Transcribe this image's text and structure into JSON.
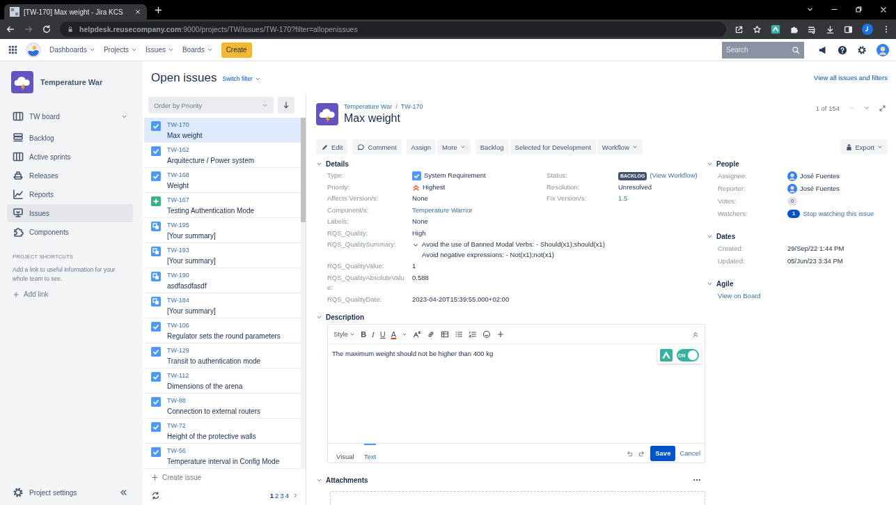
{
  "browser": {
    "tab_title": "[TW-170] Max weight - Jira KCS",
    "url": "**helpdesk.reusecompany.com**:9000/projects/TW/issues/TW-170?filter=allopenissues"
  },
  "topnav": {
    "menus": [
      "Dashboards",
      "Projects",
      "Issues",
      "Boards"
    ],
    "create": "Create",
    "search_placeholder": "Search"
  },
  "sidebar": {
    "project": "Temperature War",
    "items": [
      {
        "label": "TW board",
        "selected": false,
        "kind": "dropdown"
      },
      {
        "label": "Backlog",
        "selected": false,
        "kind": "link"
      },
      {
        "label": "Active sprints",
        "selected": false,
        "kind": "link"
      },
      {
        "label": "Releases",
        "selected": false,
        "kind": "link"
      },
      {
        "label": "Reports",
        "selected": false,
        "kind": "link"
      },
      {
        "label": "Issues",
        "selected": true,
        "kind": "link"
      },
      {
        "label": "Components",
        "selected": false,
        "kind": "link"
      }
    ],
    "shortcuts_heading": "PROJECT SHORTCUTS",
    "shortcuts_text": "Add a link to useful information for your whole team to see.",
    "add_link": "Add link",
    "settings": "Project settings"
  },
  "header": {
    "title": "Open issues",
    "switch_filter": "Switch filter",
    "view_all": "View all issues and filters"
  },
  "issue_list": {
    "order": "Order by Priority",
    "items": [
      {
        "key": "TW-170",
        "summary": "Max weight",
        "kind": "requirement",
        "selected": true
      },
      {
        "key": "TW-162",
        "summary": "Arquitecture / Power system",
        "kind": "requirement",
        "selected": false
      },
      {
        "key": "TW-168",
        "summary": "Weight",
        "kind": "requirement",
        "selected": false
      },
      {
        "key": "TW-167",
        "summary": "Testing Authentication Mode",
        "kind": "new-feature",
        "selected": false
      },
      {
        "key": "TW-195",
        "summary": "[Your summary]",
        "kind": "sub-task",
        "selected": false
      },
      {
        "key": "TW-193",
        "summary": "[Your summary]",
        "kind": "sub-task",
        "selected": false
      },
      {
        "key": "TW-190",
        "summary": "asdfasdfasdf",
        "kind": "sub-task",
        "selected": false
      },
      {
        "key": "TW-184",
        "summary": "[Your summary]",
        "kind": "sub-task",
        "selected": false
      },
      {
        "key": "TW-106",
        "summary": "Regulator sets the round parameters",
        "kind": "requirement",
        "selected": false
      },
      {
        "key": "TW-129",
        "summary": "Transit to authentication mode",
        "kind": "requirement",
        "selected": false
      },
      {
        "key": "TW-112",
        "summary": "Dimensions of the arena",
        "kind": "requirement",
        "selected": false
      },
      {
        "key": "TW-88",
        "summary": "Connection to external routers",
        "kind": "requirement",
        "selected": false
      },
      {
        "key": "TW-72",
        "summary": "Height of the protective walls",
        "kind": "requirement",
        "selected": false
      },
      {
        "key": "TW-56",
        "summary": "Temperature interval in Config Mode",
        "kind": "requirement",
        "selected": false
      }
    ],
    "create": "Create issue",
    "pages": [
      {
        "label": "1",
        "selected": true
      },
      {
        "label": "2",
        "selected": false
      },
      {
        "label": "3",
        "selected": false
      },
      {
        "label": "4",
        "selected": false
      }
    ]
  },
  "issue": {
    "breadcrumb": [
      "Temperature War",
      "TW-170"
    ],
    "separator": "/",
    "title": "Max weight",
    "toolbar": [
      [
        {
          "label": "Edit",
          "kind": "edit"
        }
      ],
      [
        {
          "label": "Comment",
          "kind": "comment"
        }
      ],
      [
        {
          "label": "Assign",
          "kind": "action"
        },
        {
          "label": "More",
          "kind": "menu"
        }
      ],
      [
        {
          "label": "Backlog",
          "kind": "action"
        },
        {
          "label": "Selected for Development",
          "kind": "action"
        },
        {
          "label": "Workflow",
          "kind": "menu"
        }
      ]
    ],
    "details_heading": "Details",
    "fields": [
      {
        "label": "Type:",
        "value": "System Requirement",
        "kind": "type"
      },
      {
        "label": "Priority:",
        "value": "Highest",
        "kind": "priority"
      },
      {
        "label": "Affects Version/s:",
        "value": "None",
        "kind": "text"
      },
      {
        "label": "Component/s:",
        "value": "Temperature Warrior",
        "kind": "link"
      },
      {
        "label": "Labels:",
        "value": "None",
        "kind": "text"
      },
      {
        "label": "RQS_Quality:",
        "value": "High",
        "kind": "text"
      },
      {
        "label": "RQS_QualitySummary:",
        "kind": "list",
        "expanded": true,
        "lines": [
          "Avoid the use of Banned Modal Verbs: - Should(x1);should(x1)",
          "Avoid negative expressions: - Not(x1);not(x1)"
        ]
      },
      {
        "label": "RQS_QualityValue:",
        "value": "1",
        "kind": "text"
      },
      {
        "label": "RQS_QualityAbsoluteValue:",
        "value": "0.588",
        "kind": "text"
      },
      {
        "label": "RQS_QualityDate:",
        "value": "2023-04-20T15:39:55.000+02:00",
        "kind": "text"
      }
    ],
    "side_fields": [
      {
        "label": "Status:",
        "kind": "status",
        "value": "BACKLOG",
        "link": "(View Workflow)"
      },
      {
        "label": "Resolution:",
        "value": "Unresolved",
        "kind": "text"
      },
      {
        "label": "Fix Version/s:",
        "value": "1.5",
        "kind": "link"
      }
    ],
    "description": {
      "heading": "Description",
      "style": "Style",
      "format": [
        "B",
        "I",
        "U",
        "A"
      ],
      "text": "The maximum weight should not be higher than 400 kg",
      "toggle": {
        "on": true,
        "label": "ON"
      },
      "modes": [
        {
          "label": "Visual",
          "selected": false
        },
        {
          "label": "Text",
          "selected": true
        }
      ],
      "save": "Save",
      "cancel": "Cancel"
    },
    "attachments_heading": "Attachments"
  },
  "side": {
    "pager": "1 of 154",
    "export": "Export",
    "sections": [
      {
        "heading": "People",
        "rows": [
          {
            "label": "Assignee:",
            "value": "José Fuentes",
            "kind": "user"
          },
          {
            "label": "Reporter:",
            "value": "José Fuentes",
            "kind": "user"
          },
          {
            "label": "Votes:",
            "value": "0",
            "kind": "count"
          },
          {
            "label": "Watchers:",
            "badge": "1",
            "value": "Stop watching this issue",
            "kind": "watch"
          }
        ]
      },
      {
        "heading": "Dates",
        "rows": [
          {
            "label": "Created:",
            "value": "29/Sep/22 1:44 PM",
            "kind": "text"
          },
          {
            "label": "Updated:",
            "value": "05/Jun/23 3:34 PM",
            "kind": "text"
          }
        ]
      },
      {
        "heading": "Agile",
        "rows": [
          {
            "value": "View on Board",
            "kind": "link"
          }
        ]
      }
    ]
  }
}
